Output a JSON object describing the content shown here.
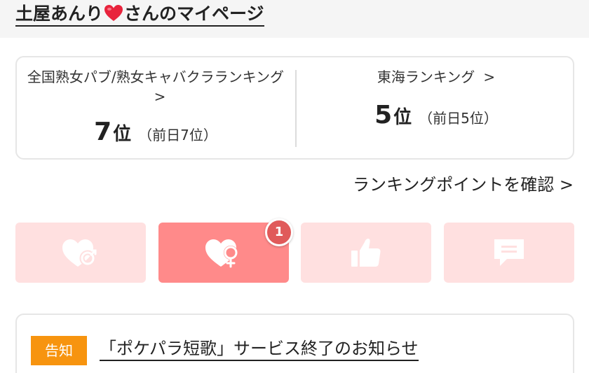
{
  "header": {
    "title_prefix": "土屋あんり",
    "title_suffix": "さんのマイページ",
    "heart_color": "#e8233c"
  },
  "ranking": {
    "national": {
      "title": "全国熟女パブ/熟女キャバクラランキング",
      "arrow": ">",
      "rank": "7",
      "unit": "位",
      "previous": "（前日7位）"
    },
    "regional": {
      "title": "東海ランキング",
      "arrow": ">",
      "rank": "5",
      "unit": "位",
      "previous": "（前日5位）"
    }
  },
  "ranking_point_link": "ランキングポイントを確認 >",
  "actions": [
    {
      "icon": "heart-male-icon",
      "active": false
    },
    {
      "icon": "heart-female-icon",
      "active": true,
      "badge": "1"
    },
    {
      "icon": "thumbs-up-icon",
      "active": false
    },
    {
      "icon": "chat-bubble-icon",
      "active": false
    }
  ],
  "notice": {
    "tag": "告知",
    "link": "「ポケパラ短歌」サービス終了のお知らせ",
    "tag_color": "#f7940f"
  },
  "colors": {
    "button_inactive": "#ffe0e0",
    "button_active": "#ff8a8a",
    "badge": "#e05a5a"
  }
}
